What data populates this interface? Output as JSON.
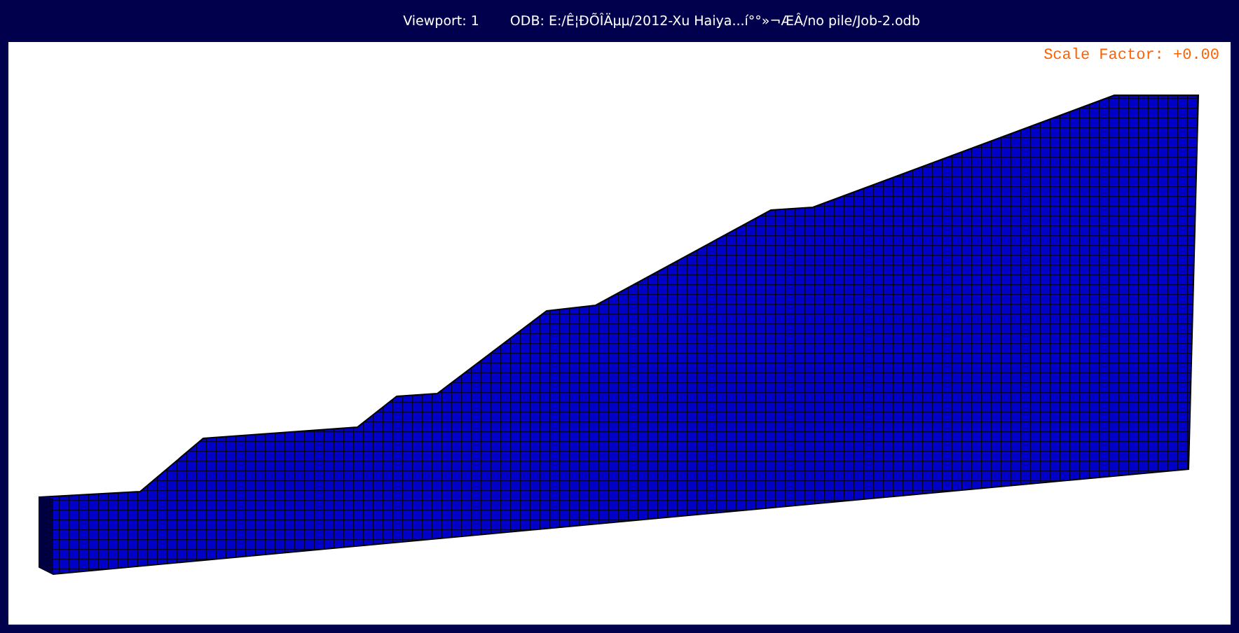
{
  "window": {
    "viewport_label": "Viewport: 1",
    "odb_path": "ODB: E:/Ê¦ÐÕÎÄµµ/2012-Xu Haiya...í°°»¬ÆÂ/no pile/Job-2.odb"
  },
  "viewport": {
    "scale_factor": "Scale Factor: +0.00"
  }
}
